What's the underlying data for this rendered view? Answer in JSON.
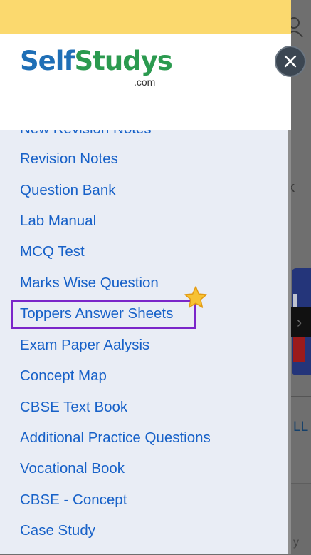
{
  "logo": {
    "brand_self": "Self",
    "brand_studys": "Studys",
    "domain": ".com"
  },
  "menu": {
    "items": [
      {
        "label": "New Revision Notes"
      },
      {
        "label": "Revision Notes"
      },
      {
        "label": "Question Bank"
      },
      {
        "label": "Lab Manual"
      },
      {
        "label": "MCQ Test"
      },
      {
        "label": "Marks Wise Question"
      },
      {
        "label": "Toppers Answer Sheets",
        "highlighted": true,
        "badge_icon": "star-icon"
      },
      {
        "label": "Exam Paper Aalysis"
      },
      {
        "label": "Concept Map"
      },
      {
        "label": "CBSE Text Book"
      },
      {
        "label": "Additional Practice Questions"
      },
      {
        "label": "Vocational Book"
      },
      {
        "label": "CBSE - Concept"
      },
      {
        "label": "Case Study"
      }
    ]
  },
  "background": {
    "partial_letter": "k",
    "partial_link": "LL",
    "partial_bottom_text": "y"
  },
  "icons": {
    "close": "close-icon",
    "user": "user-icon",
    "next": "chevron-right-icon"
  },
  "colors": {
    "top_bar": "#fbd96e",
    "drawer_bg": "#e9edf5",
    "link": "#1761c8",
    "highlight_border": "#7b26c9",
    "brand_blue": "#1f6fb6",
    "brand_green": "#2b9a4f",
    "close_button": "#3b4652"
  }
}
